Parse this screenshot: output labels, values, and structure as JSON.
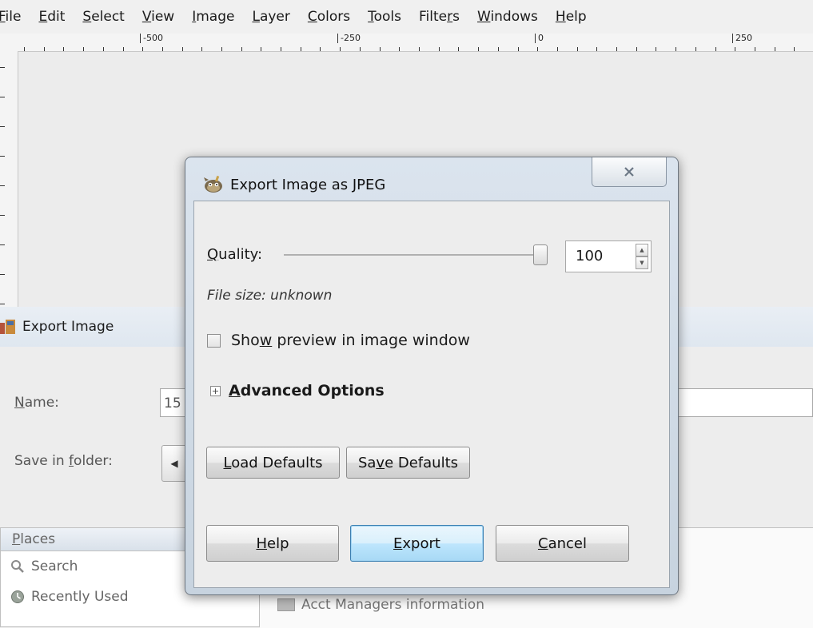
{
  "menubar": {
    "items": [
      "File",
      "Edit",
      "Select",
      "View",
      "Image",
      "Layer",
      "Colors",
      "Tools",
      "Filters",
      "Windows",
      "Help"
    ],
    "mnemonics": [
      "F",
      "E",
      "S",
      "V",
      "I",
      "L",
      "C",
      "T",
      "r",
      "W",
      "H"
    ]
  },
  "ruler": {
    "labels": [
      "-500",
      "-250",
      "0",
      "250"
    ]
  },
  "export_window": {
    "title": "Export Image",
    "name_label": "Name:",
    "name_value": "15",
    "folder_label": "Save in folder:",
    "places_header": "Places",
    "places": [
      "Search",
      "Recently Used"
    ],
    "file_item": "Acct Managers information"
  },
  "dialog": {
    "title": "Export Image as JPEG",
    "close_symbol": "✕",
    "quality_label": "Quality:",
    "quality_value": "100",
    "quality_fraction": 1.0,
    "file_size": "File size: unknown",
    "show_preview_label": "Show preview in image window",
    "show_preview_checked": false,
    "advanced_label": "Advanced Options",
    "advanced_expander": "+",
    "load_defaults": "Load Defaults",
    "save_defaults": "Save Defaults",
    "help": "Help",
    "export": "Export",
    "cancel": "Cancel"
  },
  "icons": {
    "dialog": "gimp-icon",
    "window": "export-image-icon",
    "close": "close-icon",
    "search": "search-icon",
    "recent": "recently-used-icon",
    "folder": "folder-icon"
  }
}
